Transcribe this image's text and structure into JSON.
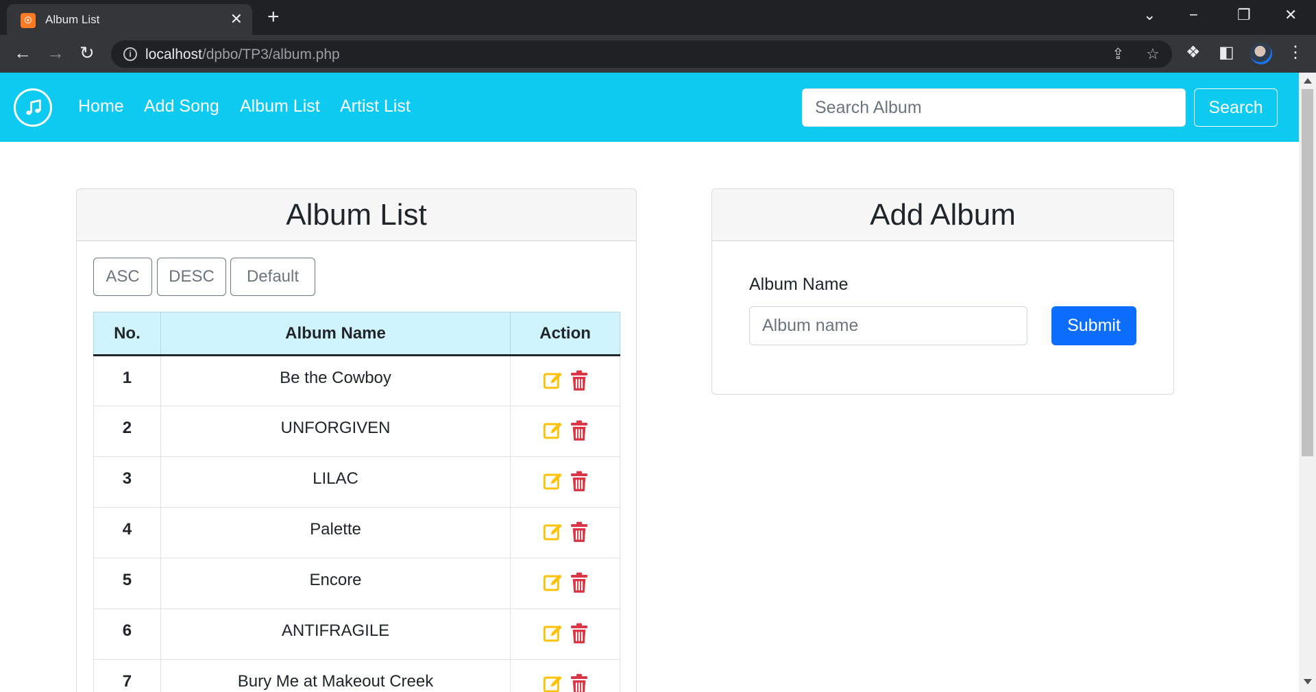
{
  "browser": {
    "tab_title": "Album List",
    "url_host": "localhost",
    "url_path": "/dpbo/TP3/album.php"
  },
  "navbar": {
    "links": [
      "Home",
      "Add Song",
      "Album List",
      "Artist List"
    ],
    "search_placeholder": "Search Album",
    "search_button": "Search"
  },
  "album_list": {
    "title": "Album List",
    "sort_buttons": [
      "ASC",
      "DESC",
      "Default"
    ],
    "columns": [
      "No.",
      "Album Name",
      "Action"
    ],
    "rows": [
      {
        "no": "1",
        "name": "Be the Cowboy"
      },
      {
        "no": "2",
        "name": "UNFORGIVEN"
      },
      {
        "no": "3",
        "name": "LILAC"
      },
      {
        "no": "4",
        "name": "Palette"
      },
      {
        "no": "5",
        "name": "Encore"
      },
      {
        "no": "6",
        "name": "ANTIFRAGILE"
      },
      {
        "no": "7",
        "name": "Bury Me at Makeout Creek"
      }
    ]
  },
  "add_album": {
    "title": "Add Album",
    "label": "Album Name",
    "placeholder": "Album name",
    "submit": "Submit"
  },
  "colors": {
    "navbar": "#0dcaf0",
    "table_head": "#cff4fc",
    "edit_icon": "#ffc107",
    "delete_icon": "#dc3545",
    "submit": "#0d6efd"
  }
}
